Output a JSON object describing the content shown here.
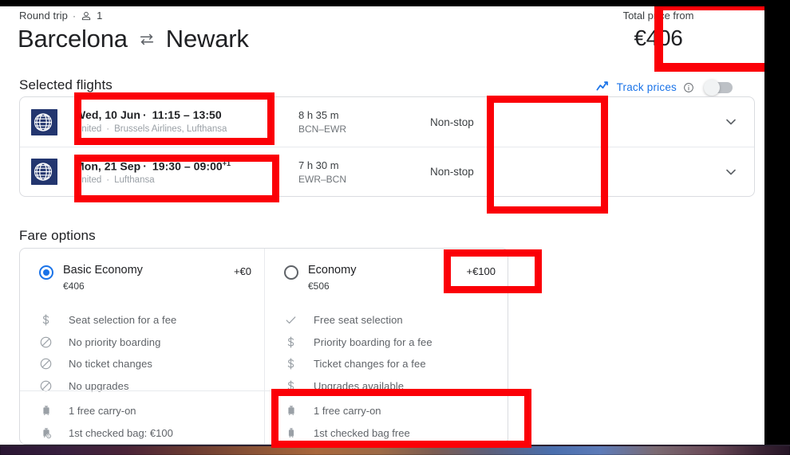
{
  "header": {
    "trip_type": "Round trip",
    "separator": "·",
    "passenger_icon": "person-icon",
    "passenger_count": "1",
    "origin": "Barcelona",
    "swap_icon": "swap-arrows-icon",
    "destination": "Newark",
    "total_price_label": "Total price from",
    "total_price_value": "€406"
  },
  "selected_flights": {
    "title": "Selected flights",
    "track_prices": {
      "trend_icon": "trend-line-icon",
      "label": "Track prices",
      "info_icon": "info-circle-icon",
      "toggle_state": "off"
    },
    "rows": [
      {
        "airline_logo": "united-airlines-globe-logo",
        "date": "Wed, 10 Jun",
        "dot": "·",
        "times": "11:15 – 13:50",
        "next_day": "",
        "operator": "United",
        "operator_sep": "·",
        "operated_by": "Brussels Airlines, Lufthansa",
        "duration": "8 h 35 m",
        "airports": "BCN–EWR",
        "stops": "Non-stop",
        "expand_icon": "chevron-down-icon"
      },
      {
        "airline_logo": "united-airlines-globe-logo",
        "date": "Mon, 21 Sep",
        "dot": "·",
        "times": "19:30 – 09:00",
        "next_day": "+1",
        "operator": "United",
        "operator_sep": "·",
        "operated_by": "Lufthansa",
        "duration": "7 h 30 m",
        "airports": "EWR–BCN",
        "stops": "Non-stop",
        "expand_icon": "chevron-down-icon"
      }
    ]
  },
  "fare_options": {
    "title": "Fare options",
    "cards": [
      {
        "selected": true,
        "name": "Basic Economy",
        "price": "€406",
        "delta": "+€0",
        "features": [
          {
            "icon": "dollar-icon",
            "label": "Seat selection for a fee"
          },
          {
            "icon": "prohibited-icon",
            "label": "No priority boarding"
          },
          {
            "icon": "prohibited-icon",
            "label": "No ticket changes"
          },
          {
            "icon": "prohibited-icon",
            "label": "No upgrades"
          }
        ],
        "bags": [
          {
            "icon": "carry-on-bag-icon",
            "label": "1 free carry-on"
          },
          {
            "icon": "checked-bag-fee-icon",
            "label": "1st checked bag: €100"
          }
        ]
      },
      {
        "selected": false,
        "name": "Economy",
        "price": "€506",
        "delta": "+€100",
        "features": [
          {
            "icon": "check-icon",
            "label": "Free seat selection"
          },
          {
            "icon": "dollar-icon",
            "label": "Priority boarding for a fee"
          },
          {
            "icon": "dollar-icon",
            "label": "Ticket changes for a fee"
          },
          {
            "icon": "dollar-icon",
            "label": "Upgrades available"
          }
        ],
        "bags": [
          {
            "icon": "carry-on-bag-icon",
            "label": "1 free carry-on"
          },
          {
            "icon": "checked-bag-free-icon",
            "label": "1st checked bag free"
          }
        ]
      }
    ]
  },
  "annotations": {
    "color": "#fb0007",
    "boxes": [
      "total-price-highlight",
      "outbound-flight-highlight",
      "return-flight-highlight",
      "non-stop-highlight",
      "economy-delta-highlight",
      "economy-bags-highlight"
    ]
  }
}
